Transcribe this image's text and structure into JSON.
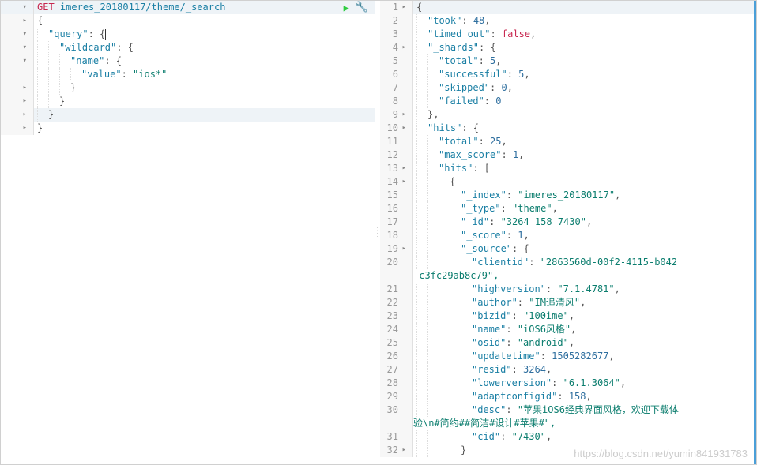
{
  "request": {
    "method": "GET",
    "url": "imeres_20180117/theme/_search",
    "lines": [
      {
        "n": "",
        "fold": "▾",
        "indent": 0,
        "type": "header"
      },
      {
        "n": "",
        "fold": "▸",
        "indent": 0,
        "tokens": [
          [
            "punc",
            "{"
          ]
        ]
      },
      {
        "n": "",
        "fold": "▾",
        "indent": 1,
        "tokens": [
          [
            "key",
            "\"query\""
          ],
          [
            "punc",
            ": "
          ],
          [
            "punc",
            "{"
          ]
        ],
        "cursor": true
      },
      {
        "n": "",
        "fold": "▾",
        "indent": 2,
        "tokens": [
          [
            "key",
            "\"wildcard\""
          ],
          [
            "punc",
            ": {"
          ]
        ]
      },
      {
        "n": "",
        "fold": "▾",
        "indent": 3,
        "tokens": [
          [
            "key",
            "\"name\""
          ],
          [
            "punc",
            ": {"
          ]
        ]
      },
      {
        "n": "",
        "fold": "",
        "indent": 4,
        "tokens": [
          [
            "key",
            "\"value\""
          ],
          [
            "punc",
            ": "
          ],
          [
            "str",
            "\"ios*\""
          ]
        ]
      },
      {
        "n": "",
        "fold": "▸",
        "indent": 3,
        "tokens": [
          [
            "punc",
            "}"
          ]
        ]
      },
      {
        "n": "",
        "fold": "▸",
        "indent": 2,
        "tokens": [
          [
            "punc",
            "}"
          ]
        ]
      },
      {
        "n": "",
        "fold": "▸",
        "indent": 1,
        "tokens": [
          [
            "punc",
            "}"
          ]
        ],
        "sel": true
      },
      {
        "n": "",
        "fold": "▸",
        "indent": 0,
        "tokens": [
          [
            "punc",
            "}"
          ]
        ]
      }
    ]
  },
  "response": {
    "lines": [
      {
        "n": "1",
        "fold": "▸",
        "indent": 0,
        "tokens": [
          [
            "punc",
            "{"
          ]
        ],
        "sel": true
      },
      {
        "n": "2",
        "fold": "",
        "indent": 1,
        "tokens": [
          [
            "key",
            "\"took\""
          ],
          [
            "punc",
            ": "
          ],
          [
            "num",
            "48"
          ],
          [
            "punc",
            ","
          ]
        ]
      },
      {
        "n": "3",
        "fold": "",
        "indent": 1,
        "tokens": [
          [
            "key",
            "\"timed_out\""
          ],
          [
            "punc",
            ": "
          ],
          [
            "bool",
            "false"
          ],
          [
            "punc",
            ","
          ]
        ]
      },
      {
        "n": "4",
        "fold": "▸",
        "indent": 1,
        "tokens": [
          [
            "key",
            "\"_shards\""
          ],
          [
            "punc",
            ": {"
          ]
        ]
      },
      {
        "n": "5",
        "fold": "",
        "indent": 2,
        "tokens": [
          [
            "key",
            "\"total\""
          ],
          [
            "punc",
            ": "
          ],
          [
            "num",
            "5"
          ],
          [
            "punc",
            ","
          ]
        ]
      },
      {
        "n": "6",
        "fold": "",
        "indent": 2,
        "tokens": [
          [
            "key",
            "\"successful\""
          ],
          [
            "punc",
            ": "
          ],
          [
            "num",
            "5"
          ],
          [
            "punc",
            ","
          ]
        ]
      },
      {
        "n": "7",
        "fold": "",
        "indent": 2,
        "tokens": [
          [
            "key",
            "\"skipped\""
          ],
          [
            "punc",
            ": "
          ],
          [
            "num",
            "0"
          ],
          [
            "punc",
            ","
          ]
        ]
      },
      {
        "n": "8",
        "fold": "",
        "indent": 2,
        "tokens": [
          [
            "key",
            "\"failed\""
          ],
          [
            "punc",
            ": "
          ],
          [
            "num",
            "0"
          ]
        ]
      },
      {
        "n": "9",
        "fold": "▸",
        "indent": 1,
        "tokens": [
          [
            "punc",
            "},"
          ]
        ]
      },
      {
        "n": "10",
        "fold": "▸",
        "indent": 1,
        "tokens": [
          [
            "key",
            "\"hits\""
          ],
          [
            "punc",
            ": {"
          ]
        ]
      },
      {
        "n": "11",
        "fold": "",
        "indent": 2,
        "tokens": [
          [
            "key",
            "\"total\""
          ],
          [
            "punc",
            ": "
          ],
          [
            "num",
            "25"
          ],
          [
            "punc",
            ","
          ]
        ]
      },
      {
        "n": "12",
        "fold": "",
        "indent": 2,
        "tokens": [
          [
            "key",
            "\"max_score\""
          ],
          [
            "punc",
            ": "
          ],
          [
            "num",
            "1"
          ],
          [
            "punc",
            ","
          ]
        ]
      },
      {
        "n": "13",
        "fold": "▸",
        "indent": 2,
        "tokens": [
          [
            "key",
            "\"hits\""
          ],
          [
            "punc",
            ": ["
          ]
        ]
      },
      {
        "n": "14",
        "fold": "▸",
        "indent": 3,
        "tokens": [
          [
            "punc",
            "{"
          ]
        ]
      },
      {
        "n": "15",
        "fold": "",
        "indent": 4,
        "tokens": [
          [
            "key",
            "\"_index\""
          ],
          [
            "punc",
            ": "
          ],
          [
            "str",
            "\"imeres_20180117\""
          ],
          [
            "punc",
            ","
          ]
        ]
      },
      {
        "n": "16",
        "fold": "",
        "indent": 4,
        "tokens": [
          [
            "key",
            "\"_type\""
          ],
          [
            "punc",
            ": "
          ],
          [
            "str",
            "\"theme\""
          ],
          [
            "punc",
            ","
          ]
        ]
      },
      {
        "n": "17",
        "fold": "",
        "indent": 4,
        "tokens": [
          [
            "key",
            "\"_id\""
          ],
          [
            "punc",
            ": "
          ],
          [
            "str",
            "\"3264_158_7430\""
          ],
          [
            "punc",
            ","
          ]
        ]
      },
      {
        "n": "18",
        "fold": "",
        "indent": 4,
        "tokens": [
          [
            "key",
            "\"_score\""
          ],
          [
            "punc",
            ": "
          ],
          [
            "num",
            "1"
          ],
          [
            "punc",
            ","
          ]
        ]
      },
      {
        "n": "19",
        "fold": "▸",
        "indent": 4,
        "tokens": [
          [
            "key",
            "\"_source\""
          ],
          [
            "punc",
            ": {"
          ]
        ]
      },
      {
        "n": "20",
        "fold": "",
        "indent": 5,
        "tokens": [
          [
            "key",
            "\"clientid\""
          ],
          [
            "punc",
            ": "
          ],
          [
            "str",
            "\"2863560d-00f2-4115-b042"
          ]
        ],
        "wrap": "-c3fc29ab8c79\","
      },
      {
        "n": "21",
        "fold": "",
        "indent": 5,
        "tokens": [
          [
            "key",
            "\"highversion\""
          ],
          [
            "punc",
            ": "
          ],
          [
            "str",
            "\"7.1.4781\""
          ],
          [
            "punc",
            ","
          ]
        ]
      },
      {
        "n": "22",
        "fold": "",
        "indent": 5,
        "tokens": [
          [
            "key",
            "\"author\""
          ],
          [
            "punc",
            ": "
          ],
          [
            "str",
            "\"IM追清风\""
          ],
          [
            "punc",
            ","
          ]
        ]
      },
      {
        "n": "23",
        "fold": "",
        "indent": 5,
        "tokens": [
          [
            "key",
            "\"bizid\""
          ],
          [
            "punc",
            ": "
          ],
          [
            "str",
            "\"100ime\""
          ],
          [
            "punc",
            ","
          ]
        ]
      },
      {
        "n": "24",
        "fold": "",
        "indent": 5,
        "tokens": [
          [
            "key",
            "\"name\""
          ],
          [
            "punc",
            ": "
          ],
          [
            "str",
            "\"iOS6风格\""
          ],
          [
            "punc",
            ","
          ]
        ]
      },
      {
        "n": "25",
        "fold": "",
        "indent": 5,
        "tokens": [
          [
            "key",
            "\"osid\""
          ],
          [
            "punc",
            ": "
          ],
          [
            "str",
            "\"android\""
          ],
          [
            "punc",
            ","
          ]
        ]
      },
      {
        "n": "26",
        "fold": "",
        "indent": 5,
        "tokens": [
          [
            "key",
            "\"updatetime\""
          ],
          [
            "punc",
            ": "
          ],
          [
            "num",
            "1505282677"
          ],
          [
            "punc",
            ","
          ]
        ]
      },
      {
        "n": "27",
        "fold": "",
        "indent": 5,
        "tokens": [
          [
            "key",
            "\"resid\""
          ],
          [
            "punc",
            ": "
          ],
          [
            "num",
            "3264"
          ],
          [
            "punc",
            ","
          ]
        ]
      },
      {
        "n": "28",
        "fold": "",
        "indent": 5,
        "tokens": [
          [
            "key",
            "\"lowerversion\""
          ],
          [
            "punc",
            ": "
          ],
          [
            "str",
            "\"6.1.3064\""
          ],
          [
            "punc",
            ","
          ]
        ]
      },
      {
        "n": "29",
        "fold": "",
        "indent": 5,
        "tokens": [
          [
            "key",
            "\"adaptconfigid\""
          ],
          [
            "punc",
            ": "
          ],
          [
            "num",
            "158"
          ],
          [
            "punc",
            ","
          ]
        ]
      },
      {
        "n": "30",
        "fold": "",
        "indent": 5,
        "tokens": [
          [
            "key",
            "\"desc\""
          ],
          [
            "punc",
            ": "
          ],
          [
            "str",
            "\"苹果iOS6经典界面风格，欢迎下载体"
          ]
        ],
        "wrap": "验\\n#简约##简洁#设计#苹果#\","
      },
      {
        "n": "31",
        "fold": "",
        "indent": 5,
        "tokens": [
          [
            "key",
            "\"cid\""
          ],
          [
            "punc",
            ": "
          ],
          [
            "str",
            "\"7430\""
          ],
          [
            "punc",
            ","
          ]
        ]
      },
      {
        "n": "32",
        "fold": "▸",
        "indent": 4,
        "tokens": [
          [
            "punc",
            "}"
          ]
        ]
      }
    ]
  },
  "watermark": "https://blog.csdn.net/yumin841931783",
  "icons": {
    "play": "▶",
    "wrench": "🔧"
  }
}
